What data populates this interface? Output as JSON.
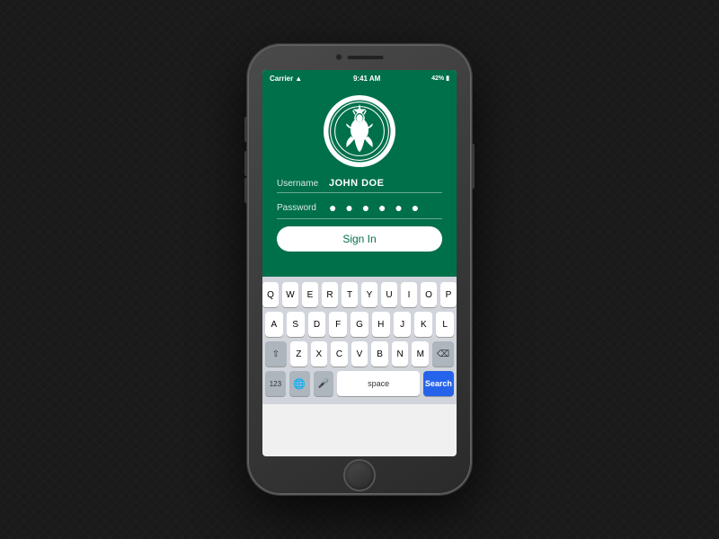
{
  "phone": {
    "status_bar": {
      "carrier": "Carrier",
      "time": "9:41 AM",
      "battery": "42%",
      "wifi_icon": "wifi",
      "battery_icon": "battery"
    },
    "app": {
      "brand_color": "#00704a",
      "logo_alt": "Starbucks Logo"
    },
    "form": {
      "username_label": "Username",
      "username_value": "JOHN DOE",
      "password_label": "Password",
      "password_dots": "● ● ● ● ● ●",
      "signin_button": "Sign In"
    },
    "keyboard": {
      "row1": [
        "Q",
        "W",
        "E",
        "R",
        "T",
        "Y",
        "U",
        "I",
        "O",
        "P"
      ],
      "row2": [
        "A",
        "S",
        "D",
        "F",
        "G",
        "H",
        "J",
        "K",
        "L"
      ],
      "row3": [
        "Z",
        "X",
        "C",
        "V",
        "B",
        "N",
        "M"
      ],
      "bottom_left": "123",
      "globe": "🌐",
      "mic": "🎤",
      "space_label": "space",
      "search_label": "Search",
      "backspace": "⌫",
      "shift": "⇧"
    }
  }
}
